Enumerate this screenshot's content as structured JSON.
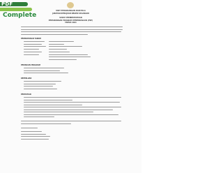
{
  "logo": {
    "top_text": "PDF",
    "bottom_text": "Complete"
  },
  "header": {
    "line1": "UNIT PERANCANGAN DAN POLA",
    "line2": "JABATAN KEMAJUAN NEGERI SELANGOR",
    "line3": "SURAT PEMBERITAHUAN",
    "line4": "PERSIDANGAN PROGRAM PEMERKASAAN (PSP)",
    "line5": "TAHUN 2021"
  },
  "sections": {
    "s1": "PERMOHONAN TARIKH",
    "s2": "PERINCIAN PROGRAM",
    "s3": "KEPERLUAN",
    "s4": "PERHATIAN"
  }
}
